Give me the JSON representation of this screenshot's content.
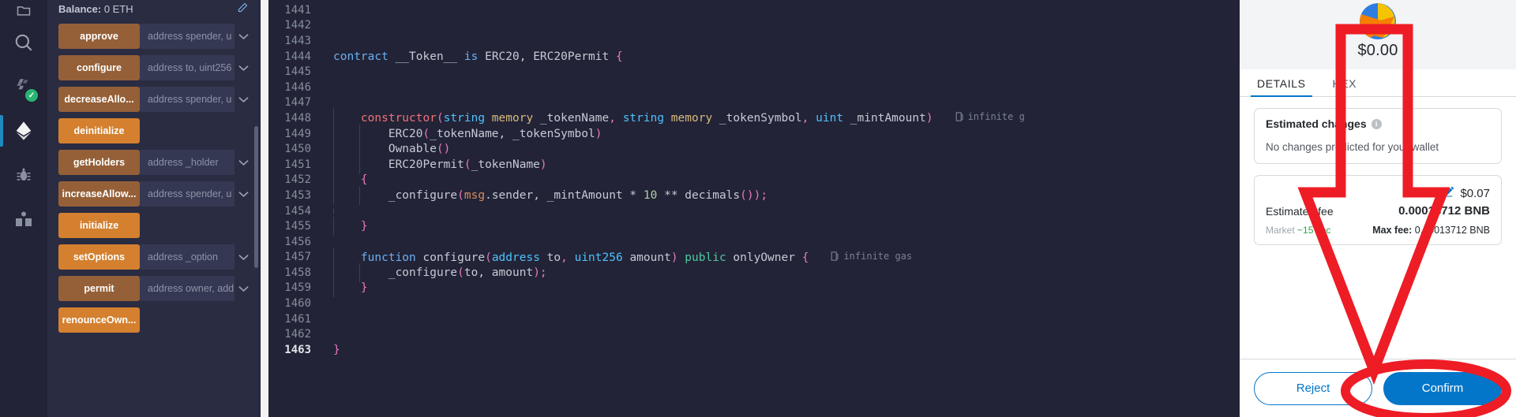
{
  "icon_rail": {
    "items": [
      {
        "name": "file-explorer-icon",
        "glyph": "files",
        "active": false,
        "badge": null
      },
      {
        "name": "search-icon",
        "glyph": "search",
        "active": false,
        "badge": null
      },
      {
        "name": "solidity-compiler-icon",
        "glyph": "compiler",
        "active": false,
        "badge": "check"
      },
      {
        "name": "deploy-run-icon",
        "glyph": "ethereum",
        "active": true,
        "badge": null
      },
      {
        "name": "debugger-icon",
        "glyph": "bug",
        "active": false,
        "badge": null
      },
      {
        "name": "learneth-icon",
        "glyph": "book",
        "active": false,
        "badge": null
      }
    ]
  },
  "udapp": {
    "balance_label": "Balance:",
    "balance_value": "0 ETH",
    "edit_icon": "edit-icon",
    "functions": [
      {
        "name": "approve",
        "style": "brown",
        "input": "address spender, u",
        "caret": true
      },
      {
        "name": "configure",
        "style": "brown",
        "input": "address to, uint256",
        "caret": true
      },
      {
        "name": "decreaseAllo...",
        "style": "brown",
        "input": "address spender, u",
        "caret": true
      },
      {
        "name": "deinitialize",
        "style": "orange",
        "input": "",
        "caret": false
      },
      {
        "name": "getHolders",
        "style": "brown",
        "input": "address _holder",
        "caret": true
      },
      {
        "name": "increaseAllow...",
        "style": "brown",
        "input": "address spender, u",
        "caret": true
      },
      {
        "name": "initialize",
        "style": "orange",
        "input": "",
        "caret": false
      },
      {
        "name": "setOptions",
        "style": "orange",
        "input": "address _option",
        "caret": true
      },
      {
        "name": "permit",
        "style": "brown",
        "input": "address owner, add",
        "caret": true
      },
      {
        "name": "renounceOwn...",
        "style": "orange",
        "input": "",
        "caret": false
      }
    ]
  },
  "editor": {
    "current_line": "1463",
    "lines": [
      {
        "num": "1441",
        "partial_top": true,
        "tokens": []
      },
      {
        "num": "1442",
        "tokens": []
      },
      {
        "num": "1443",
        "tokens": []
      },
      {
        "num": "1444",
        "tokens": [
          {
            "t": "contract ",
            "c": "k-kw"
          },
          {
            "t": "__Token__ ",
            "c": "k-id"
          },
          {
            "t": "is ",
            "c": "k-kw"
          },
          {
            "t": "ERC20, ERC20Permit ",
            "c": "k-id"
          },
          {
            "t": "{",
            "c": "k-brace"
          }
        ]
      },
      {
        "num": "1445",
        "tokens": []
      },
      {
        "num": "1446",
        "tokens": []
      },
      {
        "num": "1447",
        "tokens": []
      },
      {
        "num": "1448",
        "indent": 1,
        "tokens": [
          {
            "t": "    ",
            "c": "k-id"
          },
          {
            "t": "constructor",
            "c": "k-fn"
          },
          {
            "t": "(",
            "c": "k-paren"
          },
          {
            "t": "string ",
            "c": "k-type"
          },
          {
            "t": "memory ",
            "c": "k-memory"
          },
          {
            "t": "_tokenName",
            "c": "k-id"
          },
          {
            "t": ", ",
            "c": "k-paren"
          },
          {
            "t": "string ",
            "c": "k-type"
          },
          {
            "t": "memory ",
            "c": "k-memory"
          },
          {
            "t": "_tokenSymbol",
            "c": "k-id"
          },
          {
            "t": ", ",
            "c": "k-paren"
          },
          {
            "t": "uint ",
            "c": "k-type"
          },
          {
            "t": "_mintAmount",
            "c": "k-id"
          },
          {
            "t": ")",
            "c": "k-paren"
          }
        ],
        "gas": "infinite g"
      },
      {
        "num": "1449",
        "indent": 2,
        "tokens": [
          {
            "t": "        ",
            "c": "k-id"
          },
          {
            "t": "ERC20",
            "c": "k-id"
          },
          {
            "t": "(",
            "c": "k-paren"
          },
          {
            "t": "_tokenName, _tokenSymbol",
            "c": "k-id"
          },
          {
            "t": ")",
            "c": "k-paren"
          }
        ]
      },
      {
        "num": "1450",
        "indent": 2,
        "tokens": [
          {
            "t": "        ",
            "c": "k-id"
          },
          {
            "t": "Ownable",
            "c": "k-id"
          },
          {
            "t": "()",
            "c": "k-paren"
          }
        ]
      },
      {
        "num": "1451",
        "indent": 2,
        "tokens": [
          {
            "t": "        ",
            "c": "k-id"
          },
          {
            "t": "ERC20Permit",
            "c": "k-id"
          },
          {
            "t": "(",
            "c": "k-paren"
          },
          {
            "t": "_tokenName",
            "c": "k-id"
          },
          {
            "t": ")",
            "c": "k-paren"
          }
        ]
      },
      {
        "num": "1452",
        "indent": 1,
        "tokens": [
          {
            "t": "    ",
            "c": "k-id"
          },
          {
            "t": "{",
            "c": "k-brace"
          }
        ]
      },
      {
        "num": "1453",
        "indent": 2,
        "tokens": [
          {
            "t": "        ",
            "c": "k-id"
          },
          {
            "t": "_configure",
            "c": "k-id"
          },
          {
            "t": "(",
            "c": "k-paren"
          },
          {
            "t": "msg",
            "c": "k-obj"
          },
          {
            "t": ".sender, _mintAmount ",
            "c": "k-id"
          },
          {
            "t": "* ",
            "c": "k-id"
          },
          {
            "t": "10 ",
            "c": "k-num"
          },
          {
            "t": "** ",
            "c": "k-id"
          },
          {
            "t": "decimals",
            "c": "k-id"
          },
          {
            "t": "()",
            "c": "k-paren"
          },
          {
            "t": ");",
            "c": "k-paren"
          }
        ]
      },
      {
        "num": "1454",
        "indent": 1,
        "tokens": []
      },
      {
        "num": "1455",
        "indent": 1,
        "tokens": [
          {
            "t": "    ",
            "c": "k-id"
          },
          {
            "t": "}",
            "c": "k-brace"
          }
        ]
      },
      {
        "num": "1456",
        "tokens": []
      },
      {
        "num": "1457",
        "indent": 1,
        "tokens": [
          {
            "t": "    ",
            "c": "k-id"
          },
          {
            "t": "function ",
            "c": "k-kw"
          },
          {
            "t": "configure",
            "c": "k-id"
          },
          {
            "t": "(",
            "c": "k-paren"
          },
          {
            "t": "address ",
            "c": "k-type"
          },
          {
            "t": "to",
            "c": "k-id"
          },
          {
            "t": ", ",
            "c": "k-paren"
          },
          {
            "t": "uint256 ",
            "c": "k-type"
          },
          {
            "t": "amount",
            "c": "k-id"
          },
          {
            "t": ") ",
            "c": "k-paren"
          },
          {
            "t": "public ",
            "c": "k-green"
          },
          {
            "t": "onlyOwner ",
            "c": "k-id"
          },
          {
            "t": "{",
            "c": "k-brace"
          }
        ],
        "gas": "infinite gas"
      },
      {
        "num": "1458",
        "indent": 2,
        "tokens": [
          {
            "t": "        ",
            "c": "k-id"
          },
          {
            "t": "_configure",
            "c": "k-id"
          },
          {
            "t": "(",
            "c": "k-paren"
          },
          {
            "t": "to, amount",
            "c": "k-id"
          },
          {
            "t": ");",
            "c": "k-paren"
          }
        ]
      },
      {
        "num": "1459",
        "indent": 1,
        "tokens": [
          {
            "t": "    ",
            "c": "k-id"
          },
          {
            "t": "}",
            "c": "k-brace"
          }
        ]
      },
      {
        "num": "1460",
        "tokens": []
      },
      {
        "num": "1461",
        "tokens": []
      },
      {
        "num": "1462",
        "tokens": []
      },
      {
        "num": "1463",
        "current": true,
        "tokens": [
          {
            "t": "}",
            "c": "k-brace"
          }
        ]
      }
    ]
  },
  "metamask": {
    "avatar": "account-jazzicon",
    "amount": "$0.00",
    "tabs": [
      {
        "label": "DETAILS",
        "active": true
      },
      {
        "label": "HEX",
        "active": false
      }
    ],
    "estimated_changes": {
      "title": "Estimated changes",
      "info_icon": "info-icon",
      "body": "No changes predicted for your wallet"
    },
    "fee": {
      "edit_icon": "pencil-icon",
      "usd": "$0.07",
      "label": "Estimated fee",
      "native": "0.00013712 BNB",
      "market_label": "Market",
      "market_time": "~15 sec",
      "max_fee_label": "Max fee:",
      "max_fee_value": "0.00013712 BNB"
    },
    "buttons": {
      "reject": "Reject",
      "confirm": "Confirm"
    },
    "accent_color": "#0376c9"
  },
  "annotation": {
    "highlight_color": "#ee1c25",
    "shape": "down-arrow-pointing-to-confirm",
    "ellipse_target": "confirm-button"
  }
}
